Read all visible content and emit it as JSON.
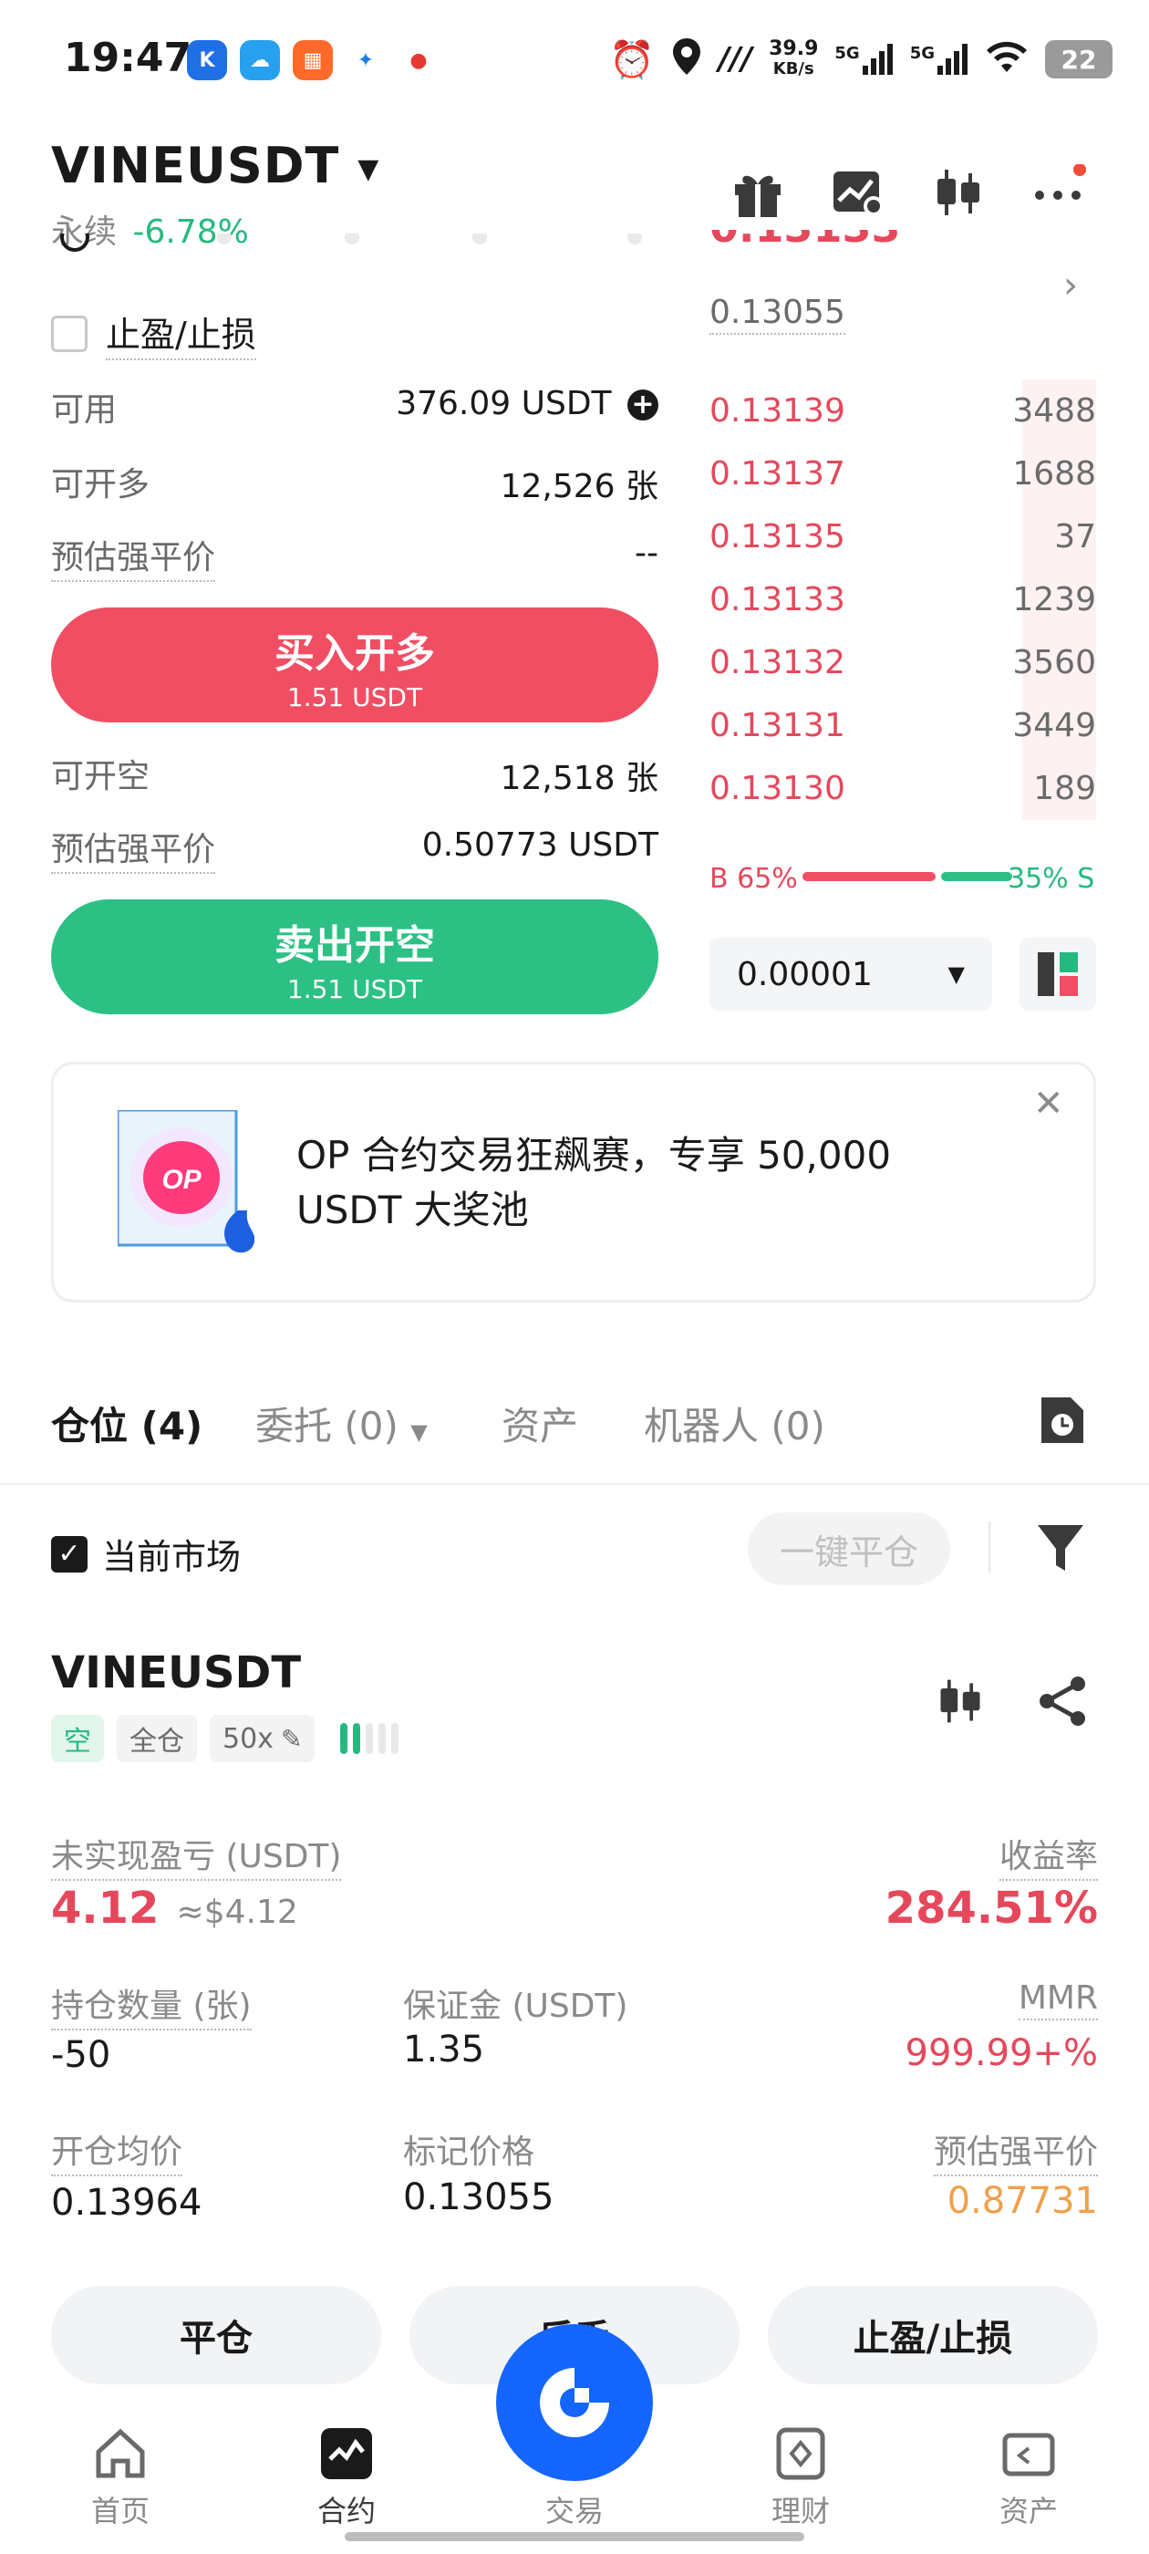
{
  "status_bar": {
    "time": "19:47",
    "net_speed_value": "39.9",
    "net_speed_unit": "KB/s",
    "sig1": "5G",
    "sig2": "5G",
    "battery": "22"
  },
  "header": {
    "pair": "VINEUSDT",
    "type": "永续",
    "change": "-6.78%"
  },
  "form": {
    "tpsl_label": "止盈/止损",
    "available_label": "可用",
    "available_value": "376.09 USDT",
    "can_long_label": "可开多",
    "can_long_value": "12,526 张",
    "liq_label_1": "预估强平价",
    "liq_value_1": "--",
    "buy_label": "买入开多",
    "buy_sub": "1.51 USDT",
    "can_short_label": "可开空",
    "can_short_value": "12,518 张",
    "liq_label_2": "预估强平价",
    "liq_value_2": "0.50773 USDT",
    "sell_label": "卖出开空",
    "sell_sub": "1.51 USDT"
  },
  "orderbook": {
    "last_price_partial": "0.13133",
    "mark_price": "0.13055",
    "asks": [
      {
        "price": "0.13139",
        "qty": "3488",
        "depth": 0.19
      },
      {
        "price": "0.13137",
        "qty": "1688",
        "depth": 0.19
      },
      {
        "price": "0.13135",
        "qty": "37",
        "depth": 0.19
      },
      {
        "price": "0.13133",
        "qty": "1239",
        "depth": 0.19
      },
      {
        "price": "0.13132",
        "qty": "3560",
        "depth": 0.19
      },
      {
        "price": "0.13131",
        "qty": "3449",
        "depth": 0.19
      },
      {
        "price": "0.13130",
        "qty": "189",
        "depth": 0.19
      }
    ],
    "buy_ratio": "B 65%",
    "sell_ratio": "35% S",
    "buy_ratio_value": 0.65,
    "tick_size": "0.00001"
  },
  "promo": {
    "badge": "OP",
    "text": "OP 合约交易狂飙赛，专享 50,000 USDT 大奖池"
  },
  "tabs": {
    "positions": "仓位 (4)",
    "orders": "委托 (0)",
    "assets": "资产",
    "bots": "机器人 (0)"
  },
  "filter": {
    "current_market": "当前市场",
    "close_all": "一键平仓"
  },
  "position": {
    "symbol": "VINEUSDT",
    "side": "空",
    "margin_mode": "全仓",
    "leverage": "50x",
    "upnl_label": "未实现盈亏 (USDT)",
    "upnl_value": "4.12",
    "upnl_usd": "≈$4.12",
    "roe_label": "收益率",
    "roe_value": "284.51%",
    "size_label": "持仓数量 (张)",
    "size_value": "-50",
    "margin_label": "保证金 (USDT)",
    "margin_value": "1.35",
    "mmr_label": "MMR",
    "mmr_value": "999.99+%",
    "entry_label": "开仓均价",
    "entry_value": "0.13964",
    "mark_label": "标记价格",
    "mark_value": "0.13055",
    "liq_label": "预估强平价",
    "liq_value": "0.87731",
    "close_btn": "平仓",
    "reverse_btn": "反手",
    "tpsl_btn": "止盈/止损"
  },
  "nav": {
    "home": "首页",
    "futures": "合约",
    "trade": "交易",
    "earn": "理财",
    "assets": "资产"
  },
  "colors": {
    "red": "#e5485b",
    "green": "#26b97f",
    "orange": "#f0a04b",
    "brand_blue": "#1565ff"
  }
}
